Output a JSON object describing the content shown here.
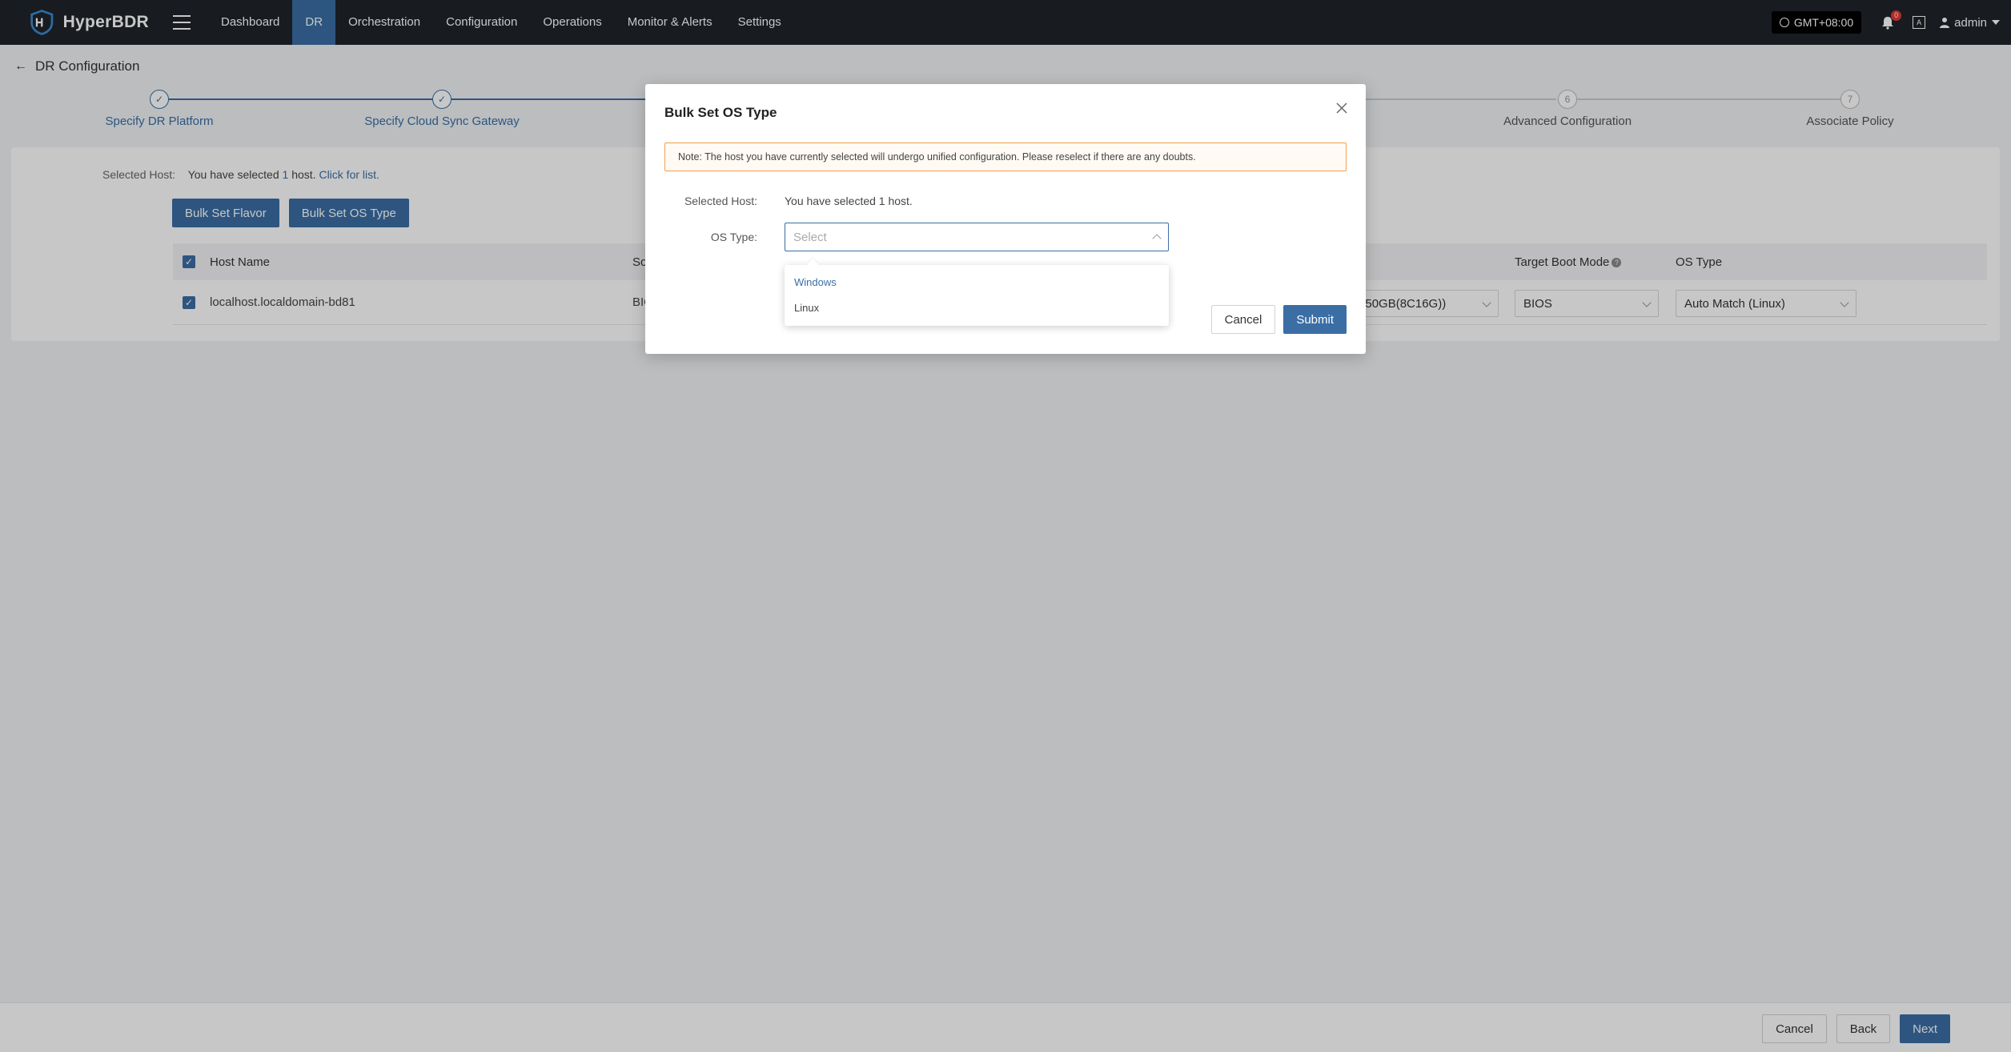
{
  "app": {
    "name": "HyperBDR"
  },
  "nav": {
    "items": [
      "Dashboard",
      "DR",
      "Orchestration",
      "Configuration",
      "Operations",
      "Monitor & Alerts",
      "Settings"
    ],
    "active": "DR"
  },
  "topright": {
    "timezone": "GMT+08:00",
    "notifications": "0",
    "lang": "A",
    "user": "admin"
  },
  "page": {
    "title": "DR Configuration"
  },
  "steps": [
    {
      "label": "Specify DR Platform",
      "state": "done",
      "num": "1"
    },
    {
      "label": "Specify Cloud Sync Gateway",
      "state": "done",
      "num": "2"
    },
    {
      "label": "Advanced Configuration",
      "state": "pending",
      "num": "6"
    },
    {
      "label": "Associate Policy",
      "state": "pending",
      "num": "7"
    }
  ],
  "main": {
    "selected_label": "Selected Host:",
    "selected_prefix": "You have selected",
    "selected_count": "1",
    "selected_suffix": "host.",
    "click_link": "Click for list.",
    "bulk_flavor": "Bulk Set Flavor",
    "bulk_os": "Bulk Set OS Type",
    "table": {
      "headers": {
        "host": "Host Name",
        "source": "Sour",
        "boot": "Target Boot Mode",
        "os": "OS Type"
      },
      "rows": [
        {
          "host": "localhost.localdomain-bd81",
          "source": "BIOS",
          "flavor": "B_50GB(8C16G))",
          "boot": "BIOS",
          "os": "Auto Match (Linux)"
        }
      ]
    }
  },
  "footer": {
    "cancel": "Cancel",
    "back": "Back",
    "next": "Next"
  },
  "modal": {
    "title": "Bulk Set OS Type",
    "note": "Note: The host you have currently selected will undergo unified configuration. Please reselect if there are any doubts.",
    "selected_label": "Selected Host:",
    "selected_value": "You have selected 1 host.",
    "os_label": "OS Type:",
    "os_placeholder": "Select",
    "options": [
      "Windows",
      "Linux"
    ],
    "highlighted": "Windows",
    "cancel": "Cancel",
    "submit": "Submit"
  },
  "colors": {
    "accent": "#3a6ea5",
    "topbar": "#1f2329",
    "warning_border": "#f0a050"
  }
}
